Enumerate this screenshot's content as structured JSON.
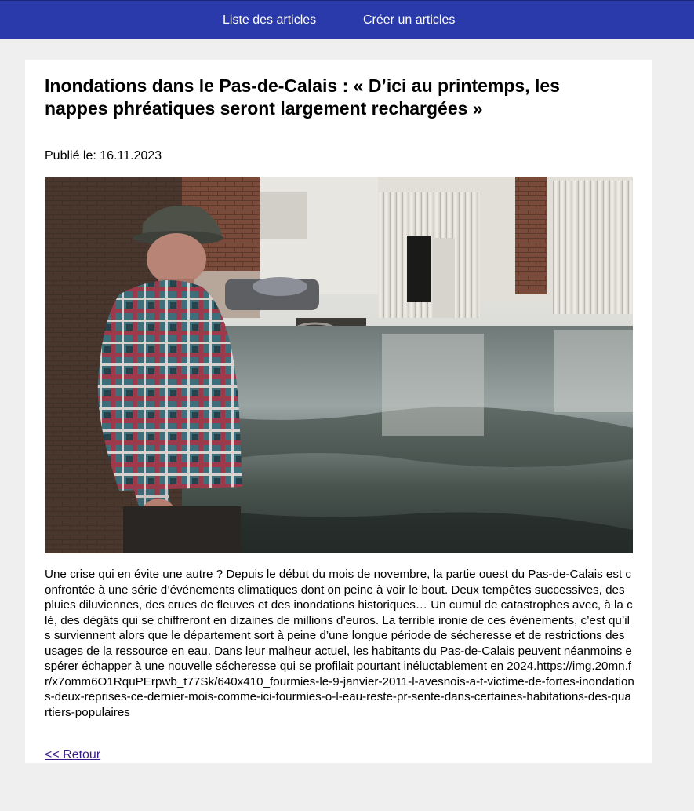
{
  "nav": {
    "list_label": "Liste des articles",
    "create_label": "Créer un articles"
  },
  "article": {
    "title": "Inondations dans le Pas-de-Calais : « D’ici au printemps, les nappes phréatiques seront largement rechargées »",
    "published_label": "Publié le: 16.11.2023",
    "body": "Une crise qui en évite une autre ? Depuis le début du mois de novembre, la partie ouest du Pas-de-Calais est confrontée à une série d’événements climatiques dont on peine à voir le bout. Deux tempêtes successives, des pluies diluviennes, des crues de fleuves et des inondations historiques… Un cumul de catastrophes avec, à la clé, des dégâts qui se chiffreront en dizaines de millions d’euros. La terrible ironie de ces événements, c’est qu’ils surviennent alors que le département sort à peine d’une longue période de sécheresse et de restrictions des usages de la ressource en eau. Dans leur malheur actuel, les habitants du Pas-de-Calais peuvent néanmoins espérer échapper à une nouvelle sécheresse qui se profilait pourtant inéluctablement en 2024.https://img.20mn.fr/x7omm6O1RquPErpwb_t77Sk/640x410_fourmies-le-9-janvier-2011-l-avesnois-a-t-victime-de-fortes-inondations-deux-reprises-ce-dernier-mois-comme-ici-fourmies-o-l-eau-reste-pr-sente-dans-certaines-habitations-des-quartiers-populaires",
    "back_label": "<< Retour"
  },
  "colors": {
    "header_bg": "#2b3aaa",
    "page_bg": "#efefef",
    "card_bg": "#ffffff",
    "link_color": "#3a1a8a"
  }
}
